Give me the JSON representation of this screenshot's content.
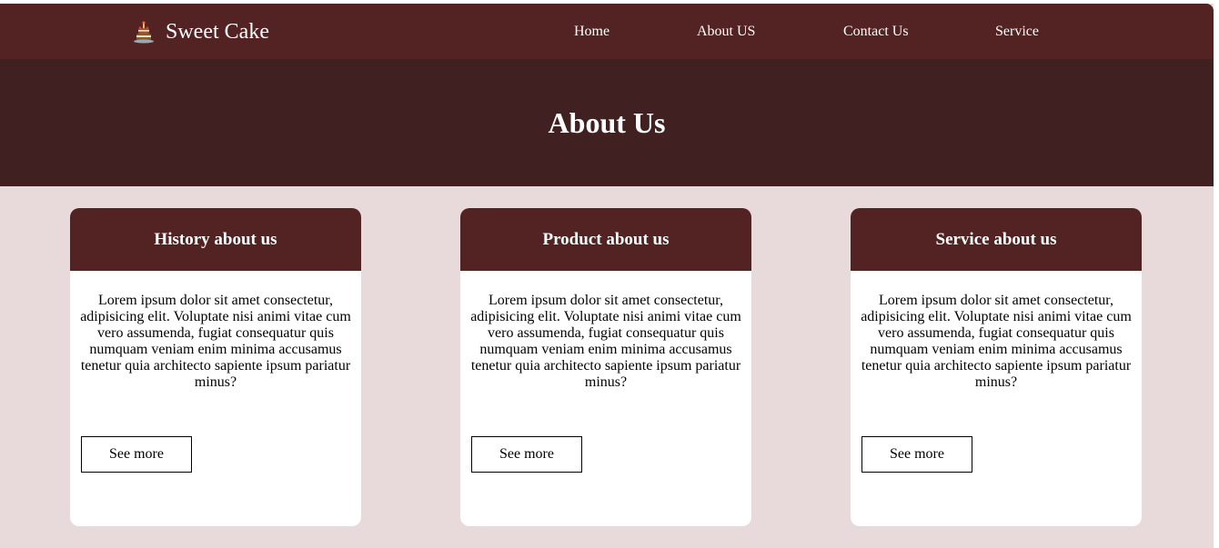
{
  "header": {
    "brand": {
      "icon": "cake-icon",
      "name": "Sweet Cake"
    },
    "nav": [
      {
        "label": "Home"
      },
      {
        "label": "About US"
      },
      {
        "label": "Contact Us"
      },
      {
        "label": "Service"
      }
    ]
  },
  "hero": {
    "title": "About Us"
  },
  "cards": [
    {
      "title": "History about us",
      "text": "Lorem ipsum dolor sit amet consectetur, adipisicing elit. Voluptate nisi animi vitae cum vero assumenda, fugiat consequatur quis numquam veniam enim minima accusamus tenetur quia architecto sapiente ipsum pariatur minus?",
      "button": "See more"
    },
    {
      "title": "Product about us",
      "text": "Lorem ipsum dolor sit amet consectetur, adipisicing elit. Voluptate nisi animi vitae cum vero assumenda, fugiat consequatur quis numquam veniam enim minima accusamus tenetur quia architecto sapiente ipsum pariatur minus?",
      "button": "See more"
    },
    {
      "title": "Service about us",
      "text": "Lorem ipsum dolor sit amet consectetur, adipisicing elit. Voluptate nisi animi vitae cum vero assumenda, fugiat consequatur quis numquam veniam enim minima accusamus tenetur quia architecto sapiente ipsum pariatur minus?",
      "button": "See more"
    }
  ],
  "colors": {
    "navbar": "#532222",
    "hero": "#402020",
    "page_background": "#e8dada",
    "card_background": "#ffffff"
  }
}
